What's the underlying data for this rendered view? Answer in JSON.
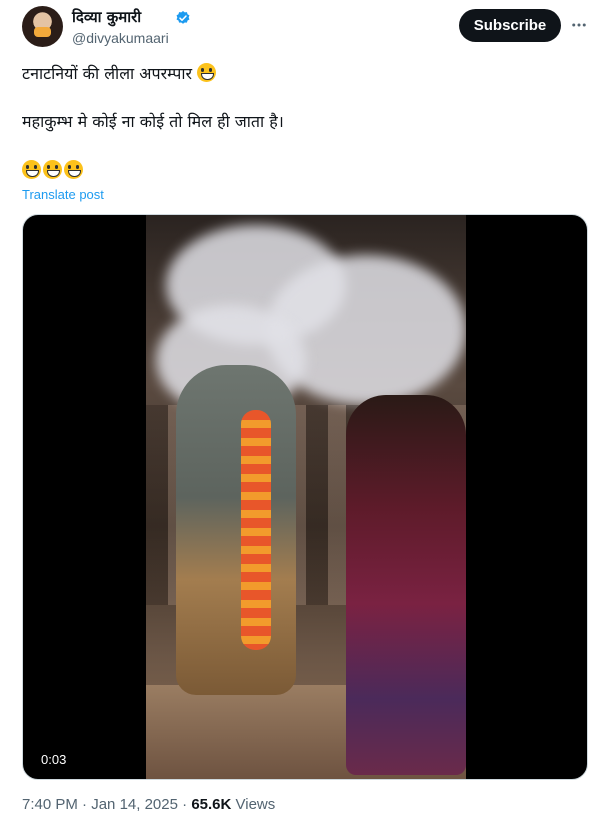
{
  "author": {
    "display_name": "दिव्या कुमारी",
    "handle": "@divyakumaari",
    "verified": true,
    "verified_color": "#1d9bf0"
  },
  "header": {
    "subscribe_label": "Subscribe",
    "more_icon": "more-horizontal-icon"
  },
  "post": {
    "line1": "टनाटनियों की लीला अपरम्पार",
    "line1_emoji": "grinning-face-emoji",
    "line2": "महाकुम्भ मे कोई ना कोई तो मिल ही जाता है।",
    "line3_emojis": [
      "grinning-face-emoji",
      "grinning-face-emoji",
      "grinning-face-emoji"
    ],
    "translate_label": "Translate post"
  },
  "media": {
    "video_time": "0:03"
  },
  "meta": {
    "time": "7:40 PM",
    "separator": "·",
    "date": "Jan 14, 2025",
    "views_count": "65.6K",
    "views_label": "Views"
  },
  "colors": {
    "link": "#1d9bf0",
    "text": "#0f1419",
    "secondary": "#536471",
    "button_bg": "#0f1419"
  }
}
